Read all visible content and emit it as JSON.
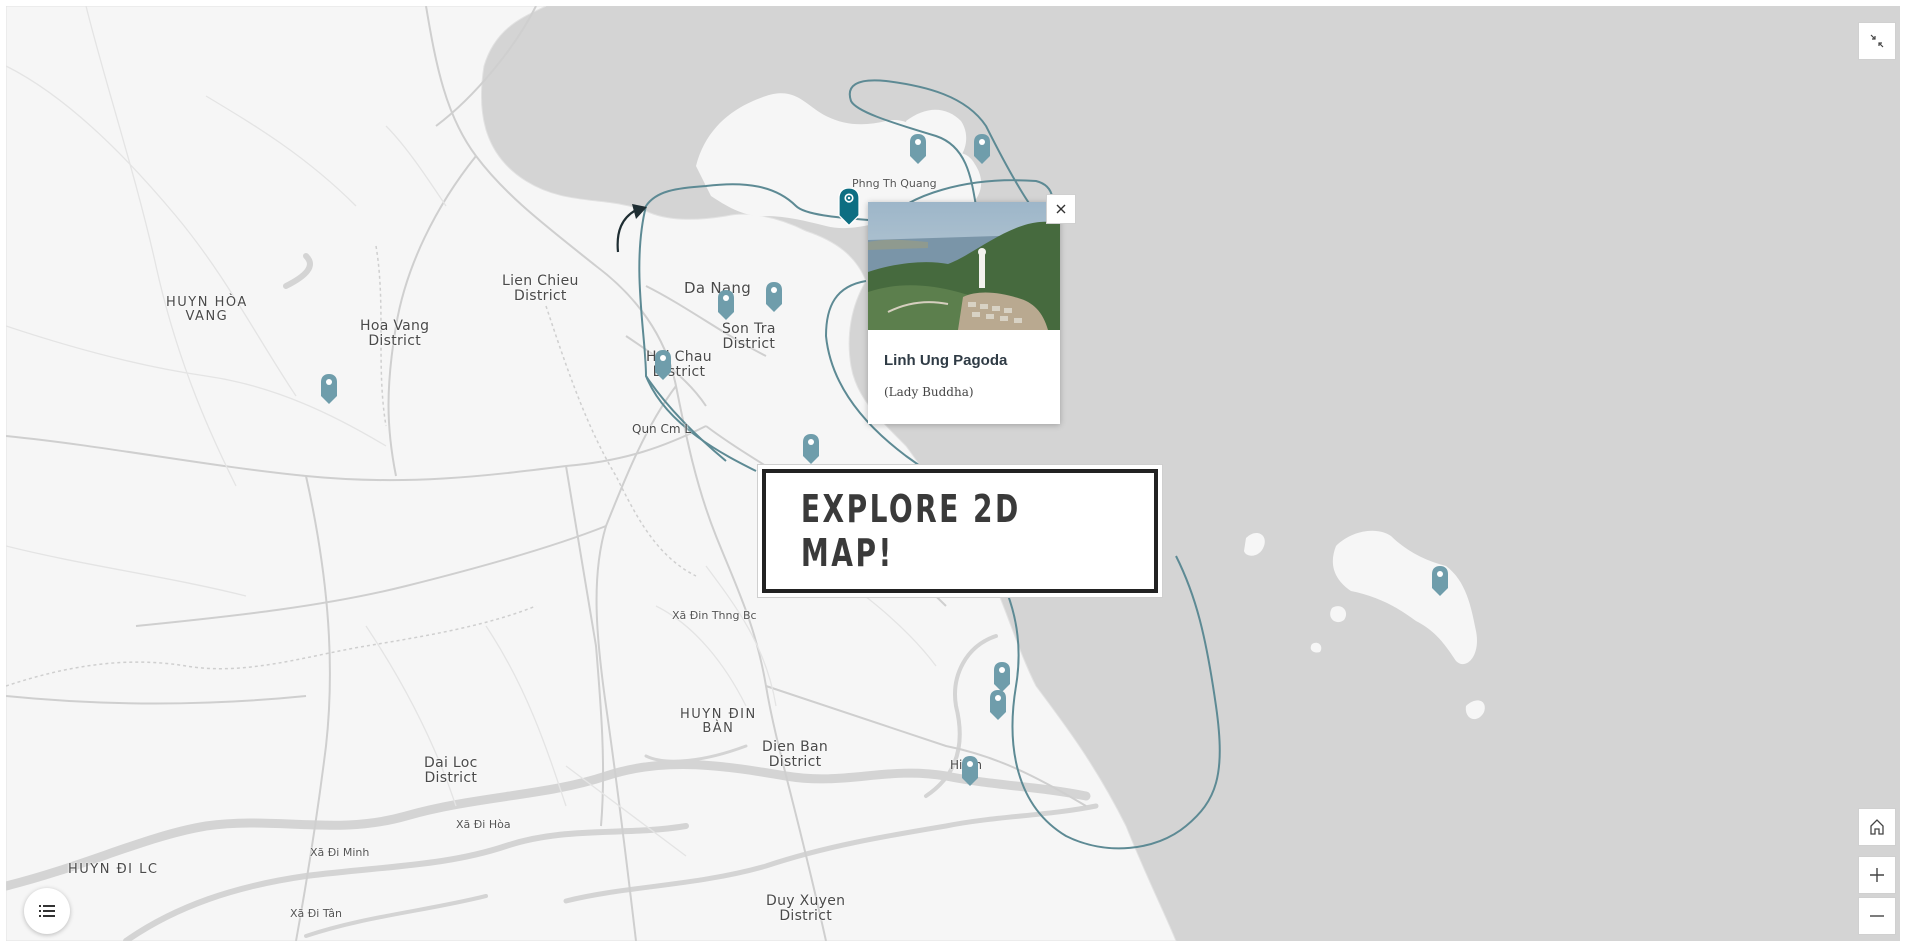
{
  "map": {
    "places": [
      {
        "id": "huyn-hoa-vang",
        "text": "HUYN HÒA\nVANG",
        "cls": "caps"
      },
      {
        "id": "hoa-vang-district",
        "text": "Hoa Vang\nDistrict",
        "cls": "lg"
      },
      {
        "id": "lien-chieu-district",
        "text": "Lien Chieu\nDistrict",
        "cls": "lg"
      },
      {
        "id": "da-nang",
        "text": "Da Nang",
        "cls": "lg"
      },
      {
        "id": "son-tra-district",
        "text": "Son Tra\nDistrict",
        "cls": "lg"
      },
      {
        "id": "hai-chau-district",
        "text": "Hai Chau\nDistrict",
        "cls": "lg"
      },
      {
        "id": "qun-cm-l",
        "text": "Qun Cm L",
        "cls": "md"
      },
      {
        "id": "phng-th-quang",
        "text": "Phng Th Quang",
        "cls": "sm"
      },
      {
        "id": "xa-din-thng-bc",
        "text": "Xã Đin Thng Bc",
        "cls": "sm"
      },
      {
        "id": "huyn-din-ban",
        "text": "HUYN ĐIN\nBÀN",
        "cls": "caps"
      },
      {
        "id": "dien-ban-district",
        "text": "Dien Ban\nDistrict",
        "cls": "lg"
      },
      {
        "id": "hoi-an",
        "text": "Hi An",
        "cls": "md"
      },
      {
        "id": "dai-loc-district",
        "text": "Dai Loc\nDistrict",
        "cls": "lg"
      },
      {
        "id": "xa-di-hoa",
        "text": "Xã Đi Hòa",
        "cls": "sm"
      },
      {
        "id": "xa-di-minh",
        "text": "Xã Đi Minh",
        "cls": "sm"
      },
      {
        "id": "huyn-di-lc",
        "text": "HUYN ĐI LC",
        "cls": "caps"
      },
      {
        "id": "xa-di-tan",
        "text": "Xã Đi Tân",
        "cls": "sm"
      },
      {
        "id": "duy-xuyen-district",
        "text": "Duy Xuyen\nDistrict",
        "cls": "lg"
      }
    ],
    "colors": {
      "land": "#f6f6f6",
      "water": "#d4d4d4",
      "route": "#5d8a94",
      "pin": "#6f9dab",
      "pin_selected": "#0d6e82"
    }
  },
  "popup": {
    "title": "Linh Ung Pagoda",
    "subtitle": "(Lady Buddha)",
    "close_icon": "close-icon"
  },
  "banner": {
    "text": "EXPLORE 2D MAP!"
  },
  "controls": {
    "collapse_icon": "collapse-icon",
    "home_icon": "home-icon",
    "zoom_in_icon": "plus-icon",
    "zoom_out_icon": "minus-icon",
    "legend_icon": "list-icon"
  }
}
